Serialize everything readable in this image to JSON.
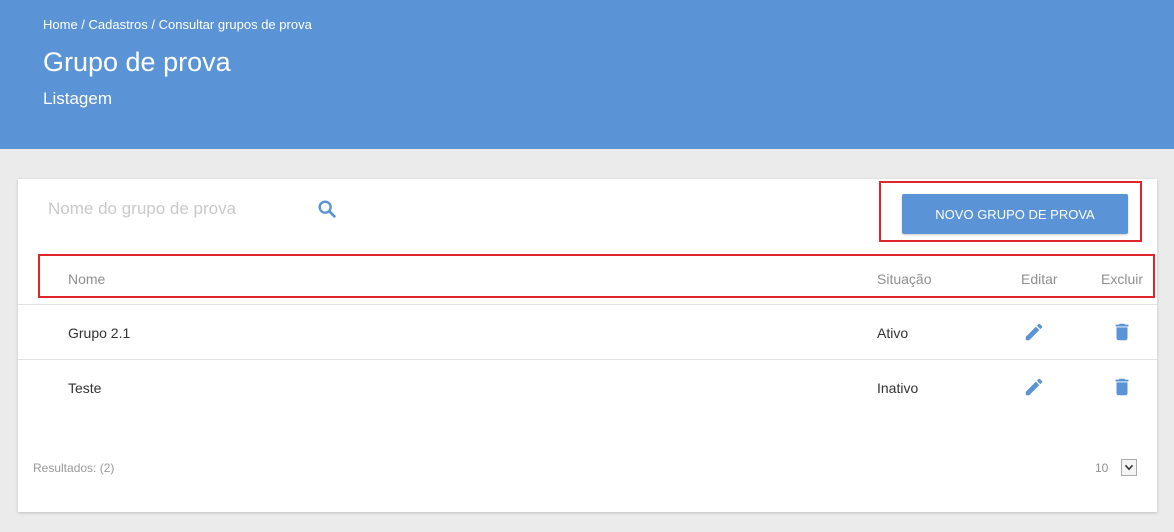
{
  "header": {
    "breadcrumb": "Home / Cadastros / Consultar grupos de prova",
    "title": "Grupo de prova",
    "subtitle": "Listagem"
  },
  "search": {
    "placeholder": "Nome do grupo de prova",
    "value": "",
    "icon": "search-icon"
  },
  "toolbar": {
    "new_label": "NOVO GRUPO DE PROVA"
  },
  "table": {
    "columns": {
      "name": "Nome",
      "status": "Situação",
      "edit": "Editar",
      "delete": "Excluir"
    },
    "rows": [
      {
        "name": "Grupo 2.1",
        "status": "Ativo",
        "edit_icon": "pencil-icon",
        "delete_icon": "trash-icon"
      },
      {
        "name": "Teste",
        "status": "Inativo",
        "edit_icon": "pencil-icon",
        "delete_icon": "trash-icon"
      }
    ]
  },
  "footer": {
    "results": "Resultados: (2)",
    "page_size": "10"
  },
  "colors": {
    "accent": "#5a94d6",
    "highlight": "#e0262b",
    "background": "#ebebeb"
  }
}
